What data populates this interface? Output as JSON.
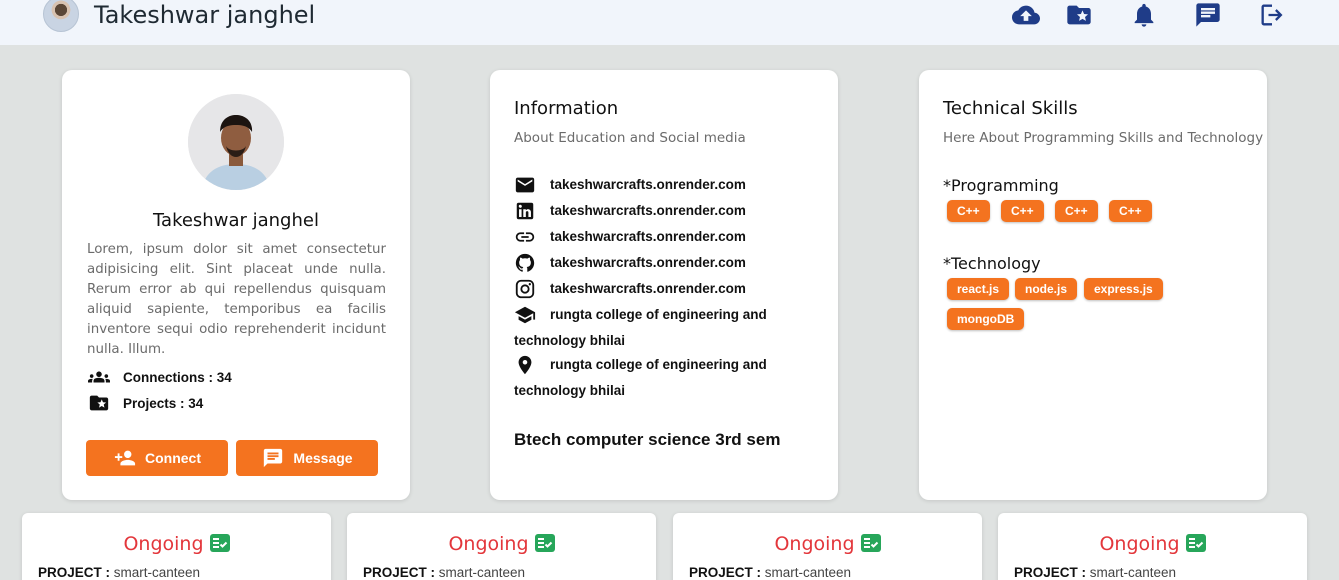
{
  "header": {
    "user_name": "Takeshwar janghel"
  },
  "profile": {
    "name": "Takeshwar janghel",
    "bio": "Lorem, ipsum dolor sit amet consectetur adipisicing elit. Sint placeat unde nulla. Rerum error ab qui repellendus quisquam aliquid sapiente, temporibus ea facilis inventore sequi odio reprehenderit incidunt nulla. Illum.",
    "connections": "Connections : 34",
    "projects": "Projects : 34",
    "connect_label": "Connect",
    "message_label": "Message"
  },
  "information": {
    "title": "Information",
    "subtitle": "About Education and Social media",
    "email": "takeshwarcrafts.onrender.com",
    "linkedin": "takeshwarcrafts.onrender.com",
    "website": "takeshwarcrafts.onrender.com",
    "github": "takeshwarcrafts.onrender.com",
    "instagram": "takeshwarcrafts.onrender.com",
    "college": "rungta college of engineering and technology bhilai",
    "location": "rungta college of engineering and technology bhilai",
    "degree": "Btech computer science 3rd sem"
  },
  "skills": {
    "title": "Technical Skills",
    "subtitle": "Here About Programming Skills and Technology",
    "programming_label": "*Programming",
    "programming": [
      "C++",
      "C++",
      "C++",
      "C++"
    ],
    "technology_label": "*Technology",
    "technology": [
      "react.js",
      "node.js",
      "express.js",
      "mongoDB"
    ]
  },
  "projects": [
    {
      "status": "Ongoing",
      "label": "PROJECT :",
      "name": "smart-canteen"
    },
    {
      "status": "Ongoing",
      "label": "PROJECT :",
      "name": "smart-canteen"
    },
    {
      "status": "Ongoing",
      "label": "PROJECT :",
      "name": "smart-canteen"
    },
    {
      "status": "Ongoing",
      "label": "PROJECT :",
      "name": "smart-canteen"
    }
  ],
  "colors": {
    "accent": "#f4731f",
    "nav_icon": "#1f3c88",
    "status": "#e3363b",
    "check": "#27a65a"
  }
}
